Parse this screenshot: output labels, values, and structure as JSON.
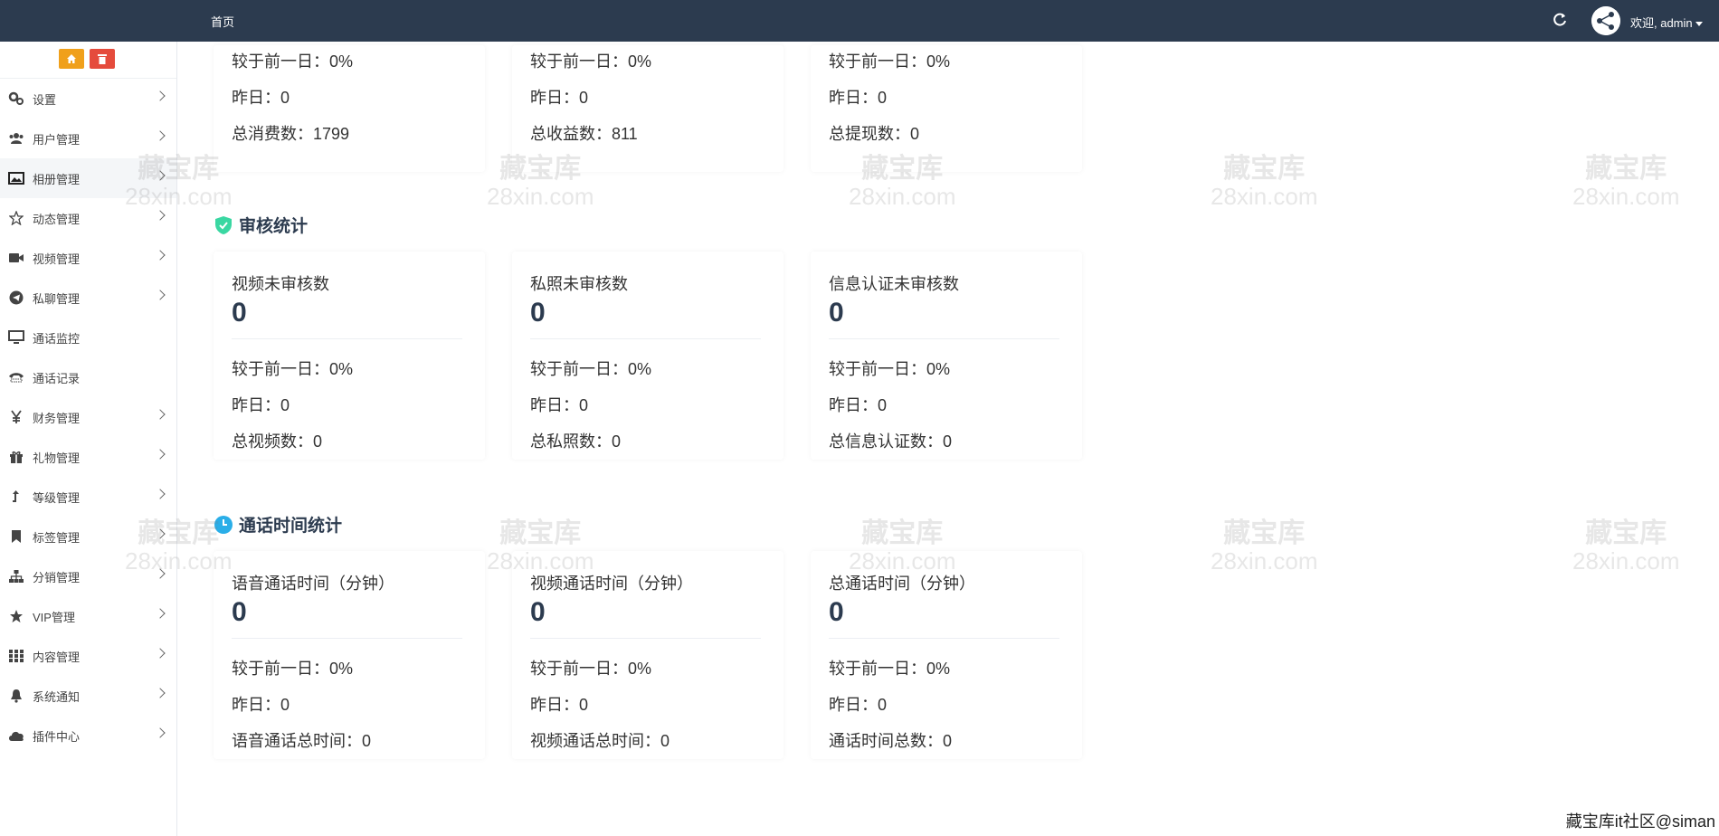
{
  "header": {
    "home_tab": "首页",
    "welcome_text": "欢迎, admin"
  },
  "sidebar": {
    "items": [
      {
        "label": "设置",
        "icon": "gears-icon",
        "has_arrow": true
      },
      {
        "label": "用户管理",
        "icon": "users-icon",
        "has_arrow": true
      },
      {
        "label": "相册管理",
        "icon": "image-icon",
        "has_arrow": true,
        "active": true
      },
      {
        "label": "动态管理",
        "icon": "star-outline-icon",
        "has_arrow": true
      },
      {
        "label": "视频管理",
        "icon": "video-camera-icon",
        "has_arrow": true
      },
      {
        "label": "私聊管理",
        "icon": "telegram-icon",
        "has_arrow": true
      },
      {
        "label": "通话监控",
        "icon": "monitor-icon",
        "has_arrow": false
      },
      {
        "label": "通话记录",
        "icon": "phone-icon",
        "has_arrow": false
      },
      {
        "label": "财务管理",
        "icon": "yen-icon",
        "has_arrow": true
      },
      {
        "label": "礼物管理",
        "icon": "gift-icon",
        "has_arrow": true
      },
      {
        "label": "等级管理",
        "icon": "level-up-icon",
        "has_arrow": true
      },
      {
        "label": "标签管理",
        "icon": "bookmark-icon",
        "has_arrow": true
      },
      {
        "label": "分销管理",
        "icon": "sitemap-icon",
        "has_arrow": true
      },
      {
        "label": "VIP管理",
        "icon": "star-icon",
        "has_arrow": true
      },
      {
        "label": "内容管理",
        "icon": "grid-icon",
        "has_arrow": true
      },
      {
        "label": "系统通知",
        "icon": "bell-icon",
        "has_arrow": true
      },
      {
        "label": "插件中心",
        "icon": "cloud-icon",
        "has_arrow": true
      }
    ]
  },
  "top_cards": [
    {
      "compare": "较于前一日：0%",
      "yesterday": "昨日：0",
      "total": "总消费数：1799"
    },
    {
      "compare": "较于前一日：0%",
      "yesterday": "昨日：0",
      "total": "总收益数：811"
    },
    {
      "compare": "较于前一日：0%",
      "yesterday": "昨日：0",
      "total": "总提现数：0"
    }
  ],
  "review_section": {
    "title": "审核统计",
    "cards": [
      {
        "label": "视频未审核数",
        "value": "0",
        "compare": "较于前一日：0%",
        "yesterday": "昨日：0",
        "total": "总视频数：0"
      },
      {
        "label": "私照未审核数",
        "value": "0",
        "compare": "较于前一日：0%",
        "yesterday": "昨日：0",
        "total": "总私照数：0"
      },
      {
        "label": "信息认证未审核数",
        "value": "0",
        "compare": "较于前一日：0%",
        "yesterday": "昨日：0",
        "total": "总信息认证数：0"
      }
    ]
  },
  "call_section": {
    "title": "通话时间统计",
    "cards": [
      {
        "label": "语音通话时间（分钟）",
        "value": "0",
        "compare": "较于前一日：0%",
        "yesterday": "昨日：0",
        "total": "语音通话总时间：0"
      },
      {
        "label": "视频通话时间（分钟）",
        "value": "0",
        "compare": "较于前一日：0%",
        "yesterday": "昨日：0",
        "total": "视频通话总时间：0"
      },
      {
        "label": "总通话时间（分钟）",
        "value": "0",
        "compare": "较于前一日：0%",
        "yesterday": "昨日：0",
        "total": "通话时间总数：0"
      }
    ]
  },
  "watermark": {
    "line1": "藏宝库",
    "line2": "28xin.com"
  },
  "corner_text": "藏宝库it社区@siman",
  "colors": {
    "topbar": "#2c3b4f",
    "home_btn": "#f0a01b",
    "delete_btn": "#e54b3c",
    "shield": "#3ad7a2",
    "clock": "#2aaee8"
  }
}
